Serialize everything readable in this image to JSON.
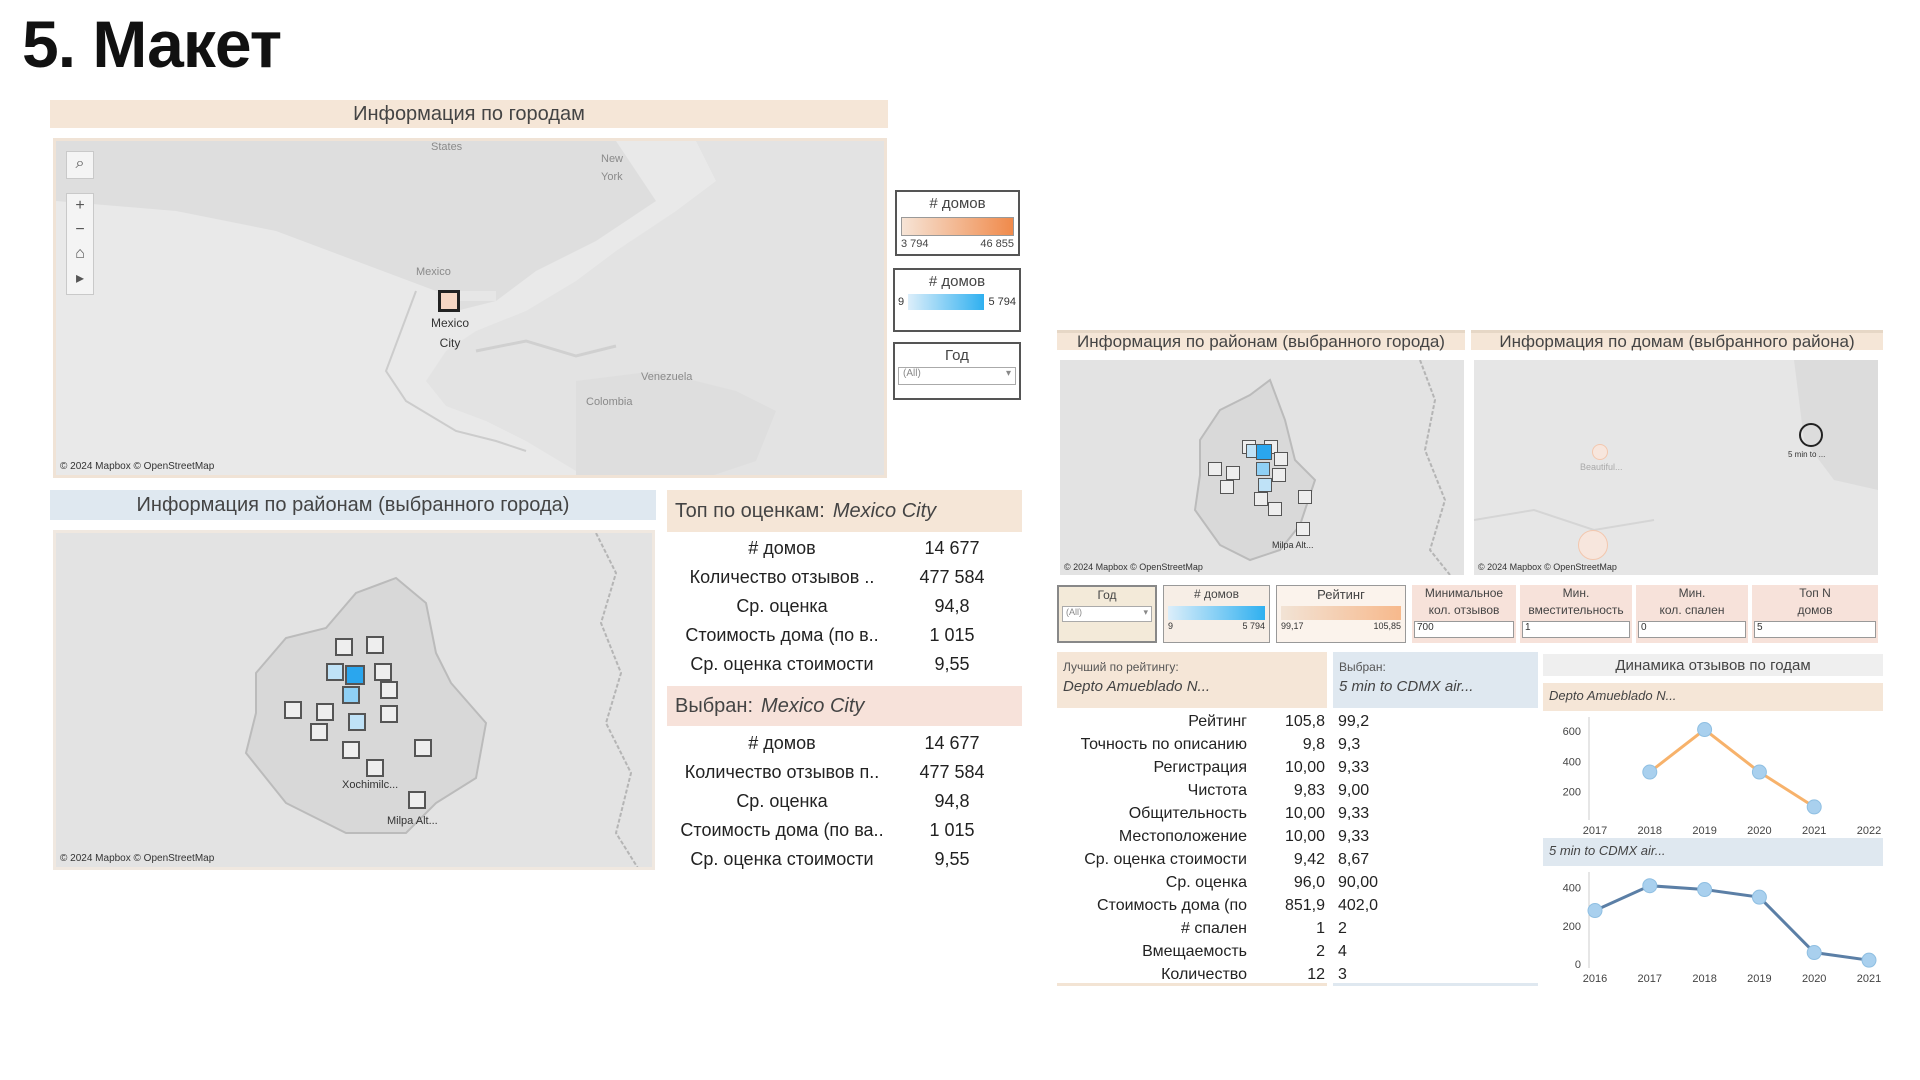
{
  "slide_title": "5. Макет",
  "left": {
    "city_header": "Информация по городам",
    "city_map": {
      "labels": [
        "States",
        "New",
        "York",
        "Mexico",
        "Mexico",
        "City",
        "Venezuela",
        "Colombia"
      ],
      "attribution": "© 2024 Mapbox  © OpenStreetMap"
    },
    "legend1": {
      "title": "# домов",
      "min": "3 794",
      "max": "46 855"
    },
    "legend2": {
      "title": "# домов",
      "min": "9",
      "max": "5 794"
    },
    "year_filter": {
      "title": "Год",
      "value": "(All)"
    },
    "district_header": "Информация по районам (выбранного города)",
    "district_map": {
      "labels": [
        "Xochimilc...",
        "Milpa Alt..."
      ],
      "attribution": "© 2024 Mapbox  © OpenStreetMap"
    },
    "top_panel": {
      "label": "Топ по оценкам:",
      "city": "Mexico City",
      "rows": [
        {
          "k": "# домов",
          "v": "14 677"
        },
        {
          "k": "Количество отзывов ..",
          "v": "477 584"
        },
        {
          "k": "Ср. оценка",
          "v": "94,8"
        },
        {
          "k": "Стоимость дома (по в..",
          "v": "1 015"
        },
        {
          "k": "Ср. оценка стоимости",
          "v": "9,55"
        }
      ]
    },
    "selected_panel": {
      "label": "Выбран:",
      "city": "Mexico City",
      "rows": [
        {
          "k": "# домов",
          "v": "14 677"
        },
        {
          "k": "Количество отзывов п..",
          "v": "477 584"
        },
        {
          "k": "Ср. оценка",
          "v": "94,8"
        },
        {
          "k": "Стоимость дома (по ва..",
          "v": "1 015"
        },
        {
          "k": "Ср. оценка стоимости",
          "v": "9,55"
        }
      ]
    }
  },
  "right": {
    "district_header": "Информация  по районам (выбранного города)",
    "house_header": "Информация по домам (выбранного района)",
    "district_map": {
      "labels": [
        "Milpa Alt..."
      ],
      "attribution": "© 2024 Mapbox  © OpenStreetMap"
    },
    "house_map": {
      "labels": [
        "Beautiful...",
        "5 min to ..."
      ],
      "attribution": "© 2024 Mapbox  © OpenStreetMap"
    },
    "filters": {
      "year": {
        "title": "Год",
        "value": "(All)"
      },
      "houses": {
        "title": "# домов",
        "min": "9",
        "max": "5 794"
      },
      "rating": {
        "title": "Рейтинг",
        "min": "99,17",
        "max": "105,85"
      },
      "min_reviews": {
        "title_1": "Минимальное",
        "title_2": "кол. отзывов",
        "value": "700"
      },
      "min_capacity": {
        "title_1": "Мин.",
        "title_2": "вместительность",
        "value": "1"
      },
      "min_bedrooms": {
        "title_1": "Мин.",
        "title_2": "кол. спален",
        "value": "0"
      },
      "top_n": {
        "title_1": "Топ N",
        "title_2": "домов",
        "value": "5"
      }
    },
    "best": {
      "label": "Лучший по рейтингу:",
      "name": "Depto Amueblado N..."
    },
    "selected": {
      "label": "Выбран:",
      "name": "5 min to CDMX air..."
    },
    "compare_rows": [
      {
        "k": "Рейтинг",
        "a": "105,8",
        "b": "99,2"
      },
      {
        "k": "Точность по описанию",
        "a": "9,8",
        "b": "9,3"
      },
      {
        "k": "Регистрация",
        "a": "10,00",
        "b": "9,33"
      },
      {
        "k": "Чистота",
        "a": "9,83",
        "b": "9,00"
      },
      {
        "k": "Общительность",
        "a": "10,00",
        "b": "9,33"
      },
      {
        "k": "Местоположение",
        "a": "10,00",
        "b": "9,33"
      },
      {
        "k": "Ср. оценка стоимости",
        "a": "9,42",
        "b": "8,67"
      },
      {
        "k": "Ср. оценка",
        "a": "96,0",
        "b": "90,00"
      },
      {
        "k": "Стоимость дома (по",
        "a": "851,9",
        "b": "402,0"
      },
      {
        "k": "# спален",
        "a": "1",
        "b": "2"
      },
      {
        "k": "Вмещаемость",
        "a": "2",
        "b": "4"
      },
      {
        "k": "Количество",
        "a": "12",
        "b": "3"
      }
    ],
    "dynamics_header": "Динамика отзывов по годам",
    "colors": {
      "orange": "#f7b26b",
      "blue": "#5b7fa6",
      "point": "#a9d0ee"
    },
    "chart_data": [
      {
        "type": "line",
        "series_label": "Depto Amueblado N...",
        "x": [
          2017,
          2018,
          2019,
          2020,
          2021,
          2022
        ],
        "y_ticks": [
          200,
          400,
          600
        ],
        "points": [
          {
            "x": 2018,
            "y": 330
          },
          {
            "x": 2019,
            "y": 610
          },
          {
            "x": 2020,
            "y": 330
          },
          {
            "x": 2021,
            "y": 100
          }
        ]
      },
      {
        "type": "line",
        "series_label": "5 min to CDMX air...",
        "x": [
          2016,
          2017,
          2018,
          2019,
          2020,
          2021
        ],
        "y_ticks": [
          0,
          200,
          400
        ],
        "points": [
          {
            "x": 2016,
            "y": 280
          },
          {
            "x": 2017,
            "y": 410
          },
          {
            "x": 2018,
            "y": 390
          },
          {
            "x": 2019,
            "y": 350
          },
          {
            "x": 2020,
            "y": 60
          },
          {
            "x": 2021,
            "y": 20
          }
        ]
      }
    ]
  }
}
